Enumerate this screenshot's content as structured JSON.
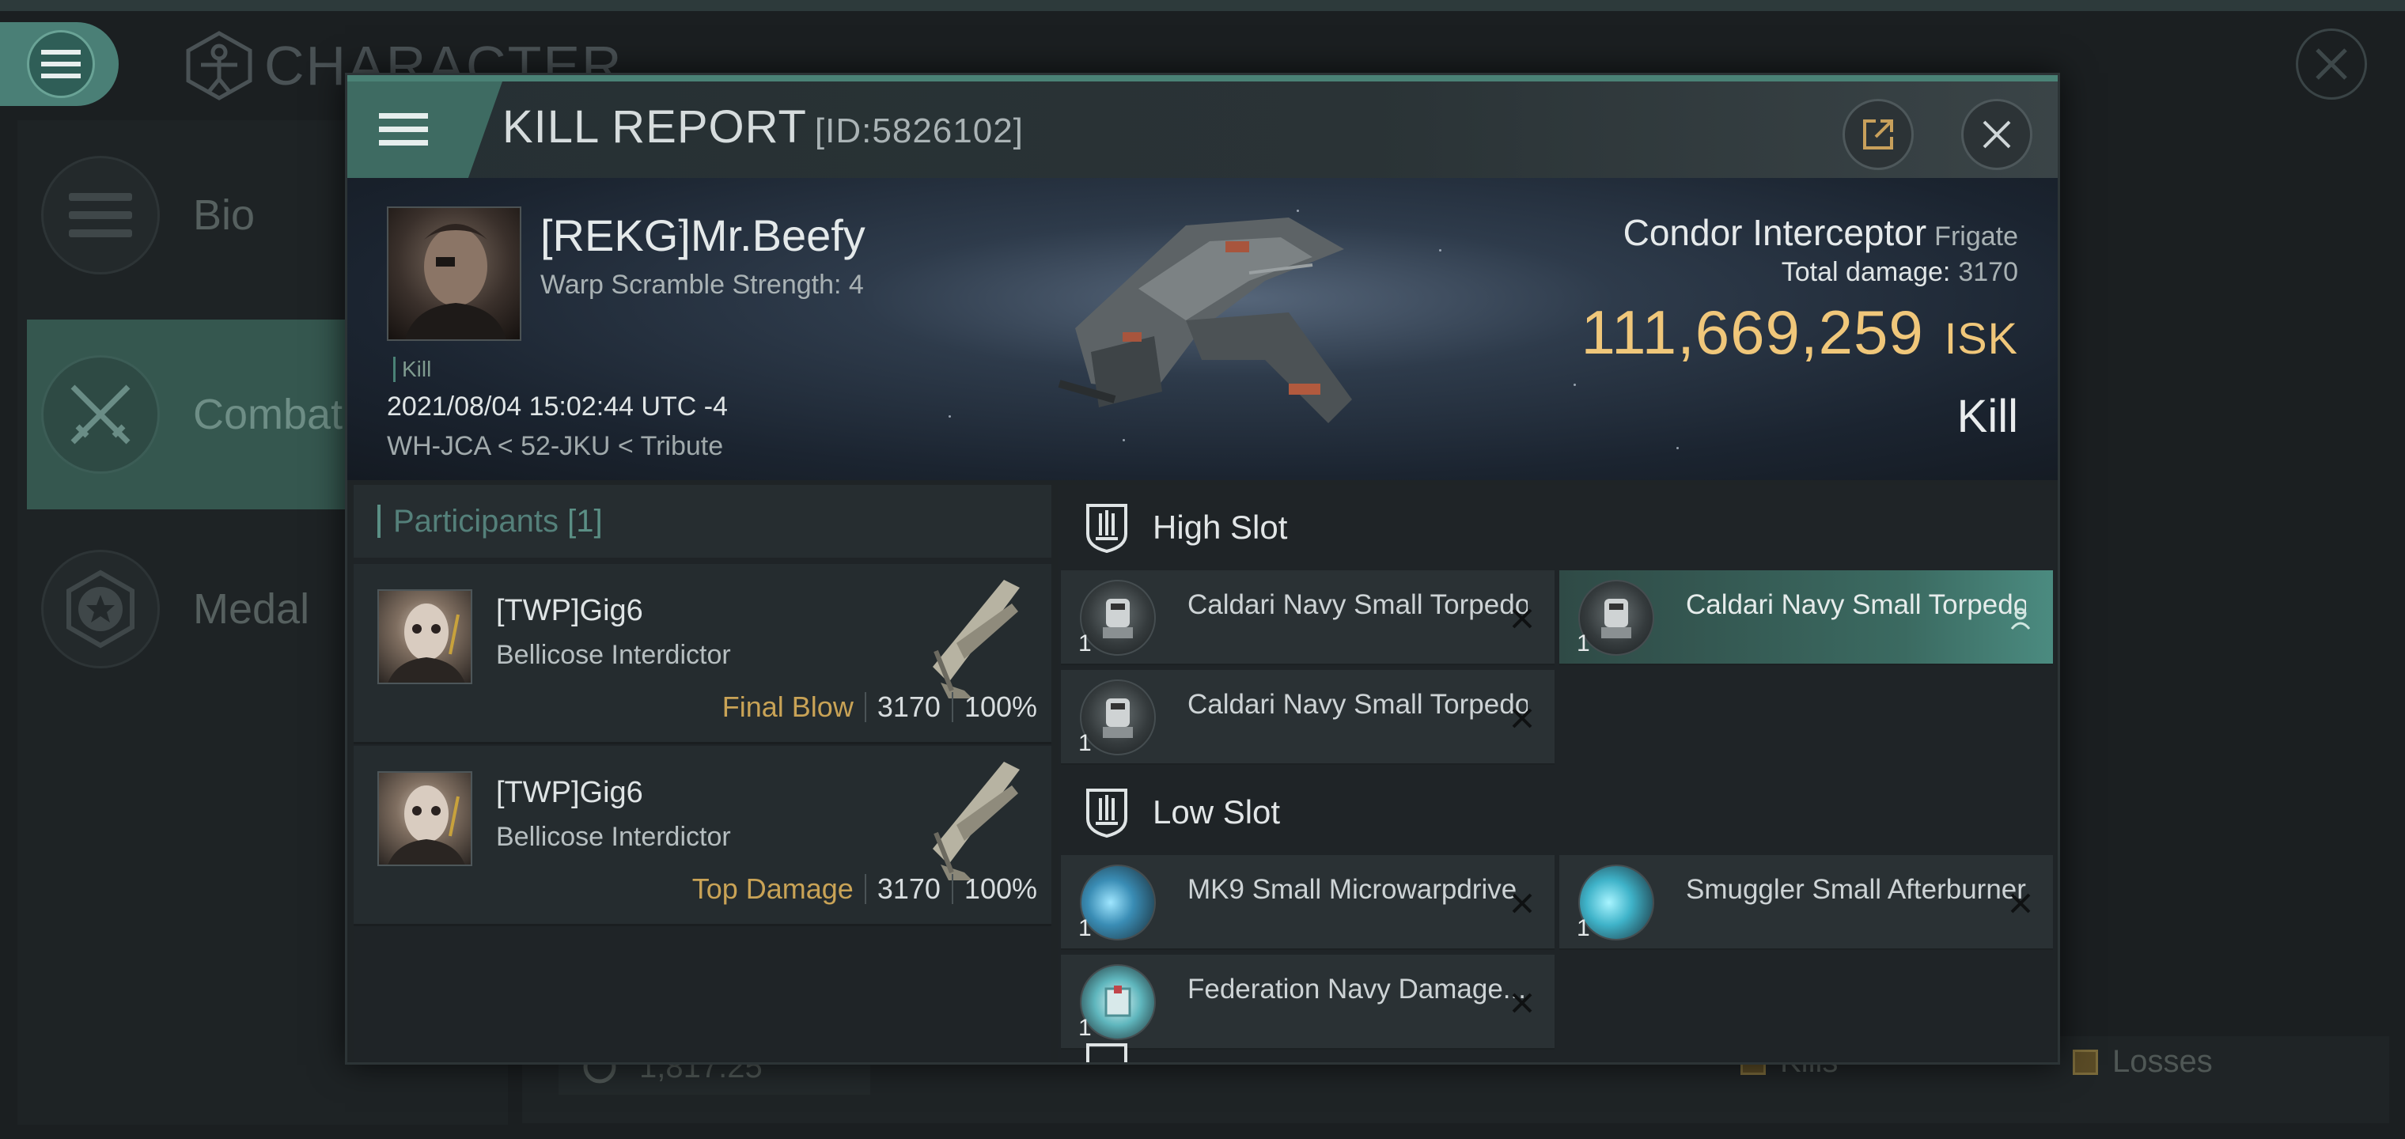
{
  "background": {
    "title": "CHARACTER",
    "sidebar": [
      {
        "label": "Bio"
      },
      {
        "label": "Combat"
      },
      {
        "label": "Medal"
      }
    ],
    "isk_display": "1,817.25",
    "legend": {
      "kills": "Kills",
      "losses": "Losses"
    }
  },
  "window": {
    "title": "KILL REPORT",
    "id": "[ID:5826102]"
  },
  "victim": {
    "name": "[REKG]Mr.Beefy",
    "subtitle": "Warp Scramble Strength: 4",
    "tag": "Kill",
    "datetime": "2021/08/04 15:02:44 UTC -4",
    "location": "WH-JCA < 52-JKU < Tribute"
  },
  "ship": {
    "name": "Condor Interceptor",
    "class": "Frigate",
    "total_damage_label": "Total damage:",
    "total_damage": "3170",
    "isk_value": "111,669,259",
    "isk_unit": "ISK",
    "result": "Kill"
  },
  "participants": {
    "label": "Participants",
    "count": "[1]",
    "rows": [
      {
        "name": "[TWP]Gig6",
        "ship": "Bellicose Interdictor",
        "tag": "Final Blow",
        "damage": "3170",
        "percent": "100%"
      },
      {
        "name": "[TWP]Gig6",
        "ship": "Bellicose Interdictor",
        "tag": "Top Damage",
        "damage": "3170",
        "percent": "100%"
      }
    ]
  },
  "slots": {
    "high": {
      "label": "High Slot",
      "items": [
        {
          "name": "Caldari Navy Small Torpedo ...",
          "qty": "1"
        },
        {
          "name": "Caldari Navy Small Torpedo ...",
          "qty": "1"
        },
        {
          "name": "Caldari Navy Small Torpedo ...",
          "qty": "1"
        }
      ]
    },
    "low": {
      "label": "Low Slot",
      "items": [
        {
          "name": "MK9 Small Microwarpdrive",
          "qty": "1"
        },
        {
          "name": "Smuggler Small Afterburner",
          "qty": "1"
        },
        {
          "name": "Federation Navy Damage...",
          "qty": "1"
        }
      ]
    }
  },
  "colors": {
    "accent": "#4a8276",
    "isk": "#f0c77a",
    "final_blow": "#c9a356"
  }
}
